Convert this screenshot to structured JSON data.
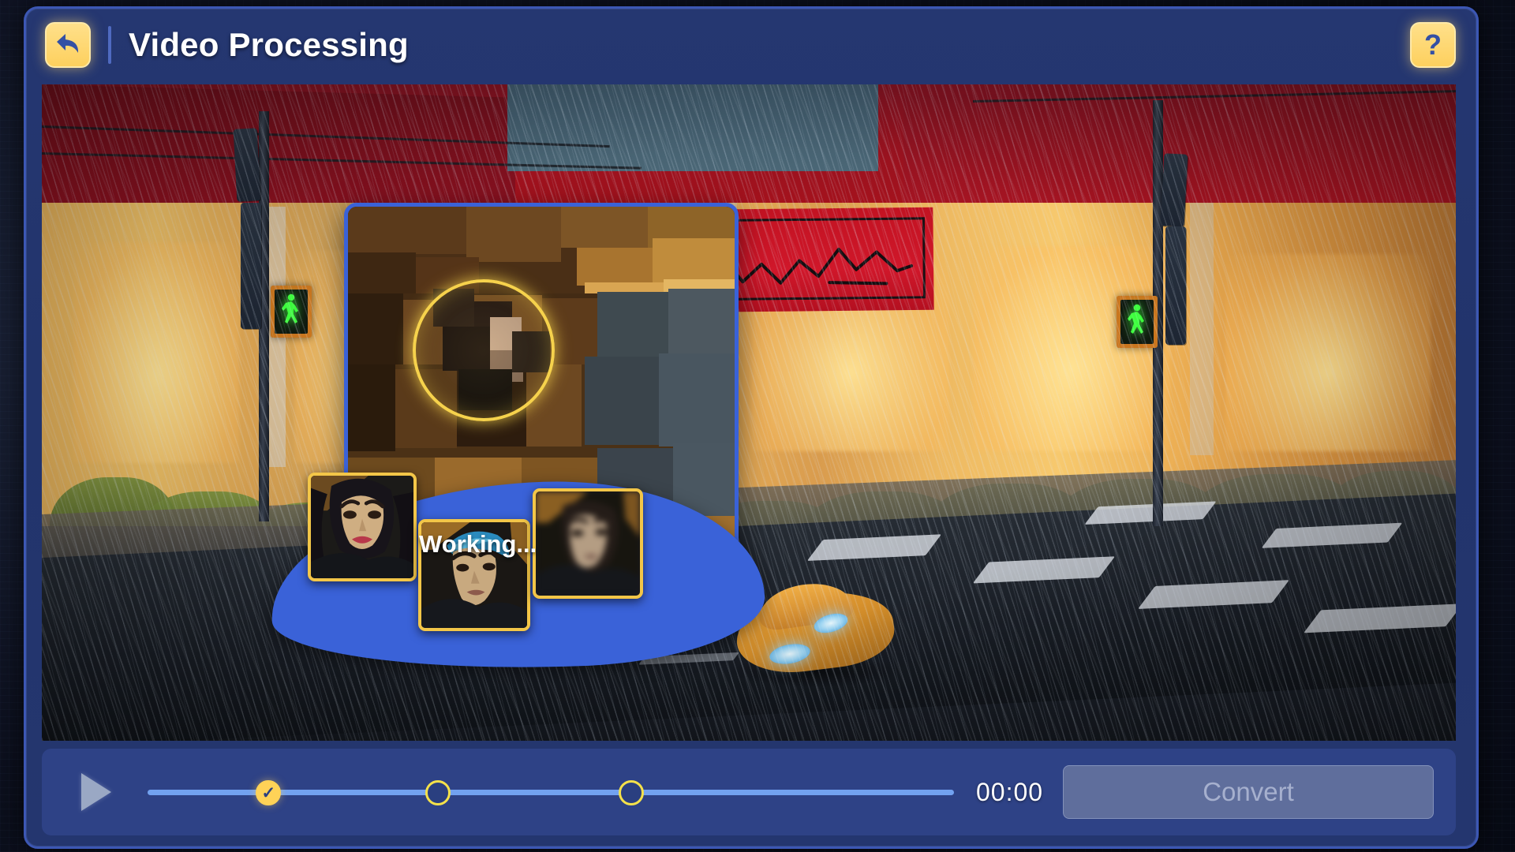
{
  "header": {
    "title": "Video Processing",
    "back_icon": "back-arrow-icon",
    "help_label": "?"
  },
  "scene": {
    "description": "Rainy night city street intersection with lit storefronts, a red awning sign, pedestrian signals and a yellow taxi",
    "shop_sign_text": "",
    "pedestrian_signal_state": "walk",
    "weather": "rain"
  },
  "dialog": {
    "status_text": "Working...",
    "reticle_icon": "scan-ring-icon",
    "thumbnails": [
      {
        "name": "face-thumbnail-1",
        "state": "identified"
      },
      {
        "name": "face-thumbnail-2",
        "state": "identified"
      },
      {
        "name": "face-thumbnail-3",
        "state": "processing"
      }
    ]
  },
  "toolbar": {
    "play_icon": "play-icon",
    "time_display": "00:00",
    "convert_label": "Convert",
    "convert_enabled": false,
    "markers": [
      {
        "position_pct": 15,
        "state": "done",
        "glyph": "✓"
      },
      {
        "position_pct": 36,
        "state": "pending",
        "glyph": ""
      },
      {
        "position_pct": 60,
        "state": "pending",
        "glyph": ""
      }
    ]
  },
  "colors": {
    "window_blue": "#253771",
    "panel_blue": "#2e4286",
    "accent_yellow": "#ffd257",
    "marker_outline": "#f4e14a",
    "track_blue": "#72a2f0",
    "blob_blue": "#3a62d8",
    "thumb_border": "#f3c648",
    "disabled_button": "#65739f",
    "disabled_text": "#b4bdd6",
    "signal_green": "#3dff3d",
    "awning_red": "#a4121d"
  }
}
